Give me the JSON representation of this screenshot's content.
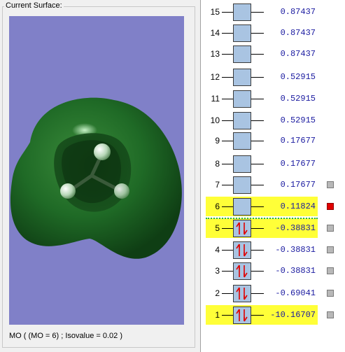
{
  "surface_panel": {
    "title": "Current Surface:",
    "caption": "MO ( (MO = 6) ; Isovalue = 0.02 )"
  },
  "colors": {
    "viewport_background": "#8080c8",
    "highlight": "#ffff38",
    "orbital_box": "#a9c4e2",
    "energy_text": "#1a1aa0",
    "selected_marker": "#e00000",
    "gap_line": "#20b050"
  },
  "orbitals": [
    {
      "num": "15",
      "energy": "0.87437",
      "occupied": false,
      "highlighted": false,
      "marker": false
    },
    {
      "num": "14",
      "energy": "0.87437",
      "occupied": false,
      "highlighted": false,
      "marker": false
    },
    {
      "num": "13",
      "energy": "0.87437",
      "occupied": false,
      "highlighted": false,
      "marker": false
    },
    {
      "num": "12",
      "energy": "0.52915",
      "occupied": false,
      "highlighted": false,
      "marker": false
    },
    {
      "num": "11",
      "energy": "0.52915",
      "occupied": false,
      "highlighted": false,
      "marker": false
    },
    {
      "num": "10",
      "energy": "0.52915",
      "occupied": false,
      "highlighted": false,
      "marker": false
    },
    {
      "num": "9",
      "energy": "0.17677",
      "occupied": false,
      "highlighted": false,
      "marker": false
    },
    {
      "num": "8",
      "energy": "0.17677",
      "occupied": false,
      "highlighted": false,
      "marker": false
    },
    {
      "num": "7",
      "energy": "0.17677",
      "occupied": false,
      "highlighted": false,
      "marker": "gray"
    },
    {
      "num": "6",
      "energy": "0.11824",
      "occupied": false,
      "highlighted": true,
      "marker": "red"
    },
    {
      "num": "5",
      "energy": "-0.38831",
      "occupied": true,
      "highlighted": true,
      "marker": "gray"
    },
    {
      "num": "4",
      "energy": "-0.38831",
      "occupied": true,
      "highlighted": false,
      "marker": "gray"
    },
    {
      "num": "3",
      "energy": "-0.38831",
      "occupied": true,
      "highlighted": false,
      "marker": "gray"
    },
    {
      "num": "2",
      "energy": "-0.69041",
      "occupied": true,
      "highlighted": false,
      "marker": "gray"
    },
    {
      "num": "1",
      "energy": "-10.16707",
      "occupied": true,
      "highlighted": true,
      "marker": "gray"
    }
  ]
}
